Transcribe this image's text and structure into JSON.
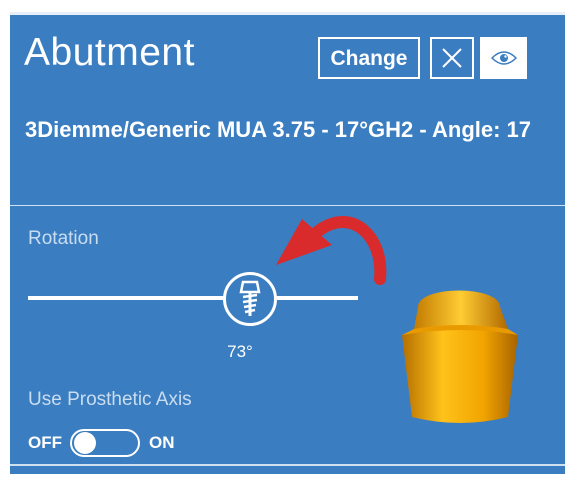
{
  "panel": {
    "title": "Abutment",
    "change_label": "Change",
    "close_icon": "close-icon",
    "visibility_icon": "eye-icon",
    "model_name": "3Diemme/Generic MUA 3.75 - 17°GH2 - Angle: 17"
  },
  "rotation": {
    "label": "Rotation",
    "value_label": "73°",
    "value_degrees": 73,
    "handle_icon": "implant-icon",
    "hint_icon": "rotate-arrow-icon"
  },
  "prosthetic_axis": {
    "label": "Use Prosthetic Axis",
    "off_label": "OFF",
    "on_label": "ON",
    "state": "off"
  },
  "colors": {
    "panel_background": "#3a7dc0",
    "accent_arrow": "#d92b2b",
    "abutment_gold": "#f2a400"
  }
}
